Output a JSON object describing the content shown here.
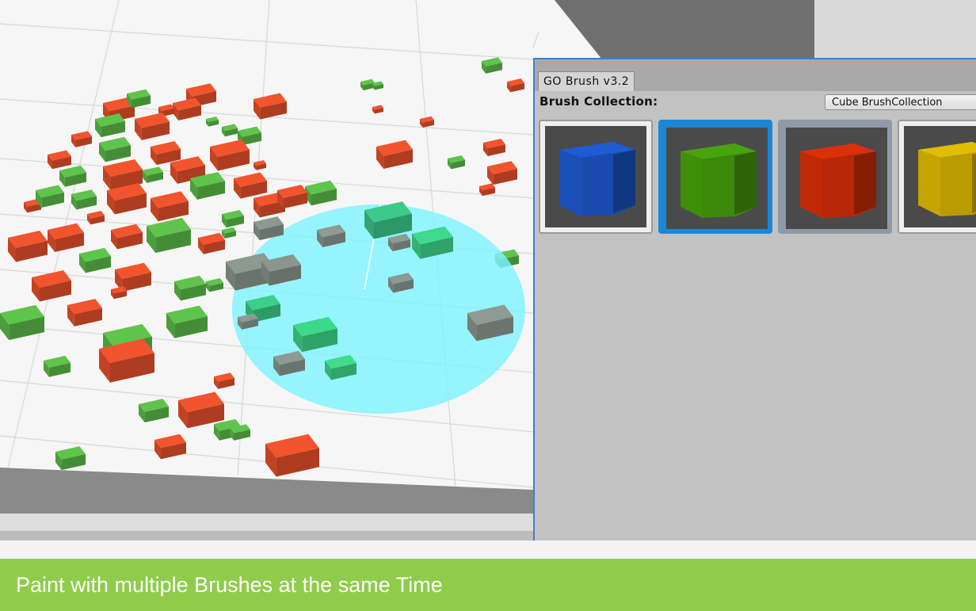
{
  "panel": {
    "tab_title": "GO Brush v3.2",
    "collection_label": "Brush Collection:",
    "collection_value": "Cube BrushCollection",
    "brushes": [
      {
        "name": "blue-cube",
        "color": "#1a4fb8",
        "selected": false
      },
      {
        "name": "green-cube",
        "color": "#3f8f0a",
        "selected": true
      },
      {
        "name": "red-cube",
        "color": "#c02a07",
        "selected": true
      },
      {
        "name": "yellow-cube",
        "color": "#c4a400",
        "selected": false
      }
    ]
  },
  "caption": {
    "text": "Paint with multiple Brushes at the same Time"
  },
  "colors": {
    "accent_blue": "#3d7fd6",
    "caption_green": "#8fcc4a",
    "brush_cyan": "#7ff3ff",
    "cube_red": "#f2542d",
    "cube_green": "#5fc44b"
  }
}
